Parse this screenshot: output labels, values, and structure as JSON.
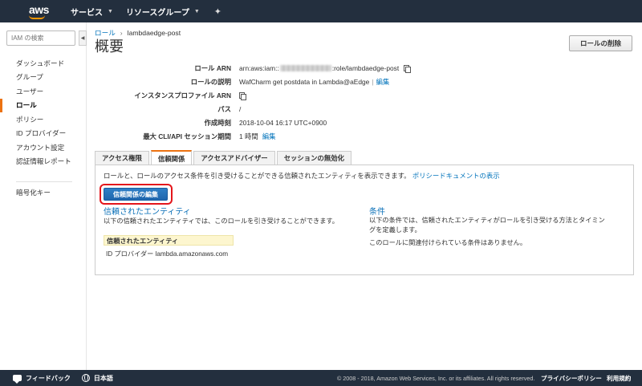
{
  "topbar": {
    "logo_text": "aws",
    "services_label": "サービス",
    "resource_groups_label": "リソースグループ"
  },
  "sidebar": {
    "search_placeholder": "IAM の検索",
    "items": [
      {
        "label": "ダッシュボード"
      },
      {
        "label": "グループ"
      },
      {
        "label": "ユーザー"
      },
      {
        "label": "ロール"
      },
      {
        "label": "ポリシー"
      },
      {
        "label": "ID プロバイダー"
      },
      {
        "label": "アカウント設定"
      },
      {
        "label": "認証情報レポート"
      }
    ],
    "extra_items": [
      {
        "label": "暗号化キー"
      }
    ]
  },
  "breadcrumb": {
    "parent": "ロール",
    "current": "lambdaedge-post"
  },
  "page_title": "概要",
  "delete_button": "ロールの削除",
  "summary": {
    "role_arn_label": "ロール ARN",
    "role_arn_prefix": "arn:aws:iam::",
    "role_arn_suffix": ":role/lambdaedge-post",
    "description_label": "ロールの説明",
    "description_value": "WafCharm get postdata in Lambda@aEdge",
    "edit_link": "編集",
    "instance_profile_label": "インスタンスプロファイル ARN",
    "path_label": "パス",
    "path_value": "/",
    "created_label": "作成時刻",
    "created_value": "2018-10-04 16:17 UTC+0900",
    "max_session_label": "最大 CLI/API セッション期間",
    "max_session_value": "1 時間"
  },
  "tabs": [
    {
      "label": "アクセス権限"
    },
    {
      "label": "信頼関係"
    },
    {
      "label": "アクセスアドバイザー"
    },
    {
      "label": "セッションの無効化"
    }
  ],
  "trust": {
    "description": "ロールと、ロールのアクセス条件を引き受けることができる信頼されたエンティティを表示できます。",
    "policy_doc_link": "ポリシードキュメントの表示",
    "edit_button": "信頼関係の編集",
    "entities_title": "信頼されたエンティティ",
    "entities_desc": "以下の信頼されたエンティティでは、このロールを引き受けることができます。",
    "entities_table_header": "信頼されたエンティティ",
    "entities_row": "ID プロバイダー lambda.amazonaws.com",
    "conditions_title": "条件",
    "conditions_desc": "以下の条件では、信頼されたエンティティがロールを引き受ける方法とタイミングを定義します。",
    "conditions_none": "このロールに関連付けられている条件はありません。"
  },
  "footer": {
    "feedback": "フィードバック",
    "language": "日本語",
    "copyright": "© 2008 - 2018, Amazon Web Services, Inc. or its affiliates. All rights reserved.",
    "privacy": "プライバシーポリシー",
    "terms": "利用規約"
  },
  "colors": {
    "nav_bg": "#232f3e",
    "accent_orange": "#ec7211",
    "link_blue": "#0073bb",
    "highlight_red": "#e4161b"
  },
  "icons": [
    "aws-logo",
    "chevron-down-icon",
    "pin-icon",
    "collapse-icon",
    "copy-icon",
    "chat-icon",
    "globe-icon"
  ]
}
